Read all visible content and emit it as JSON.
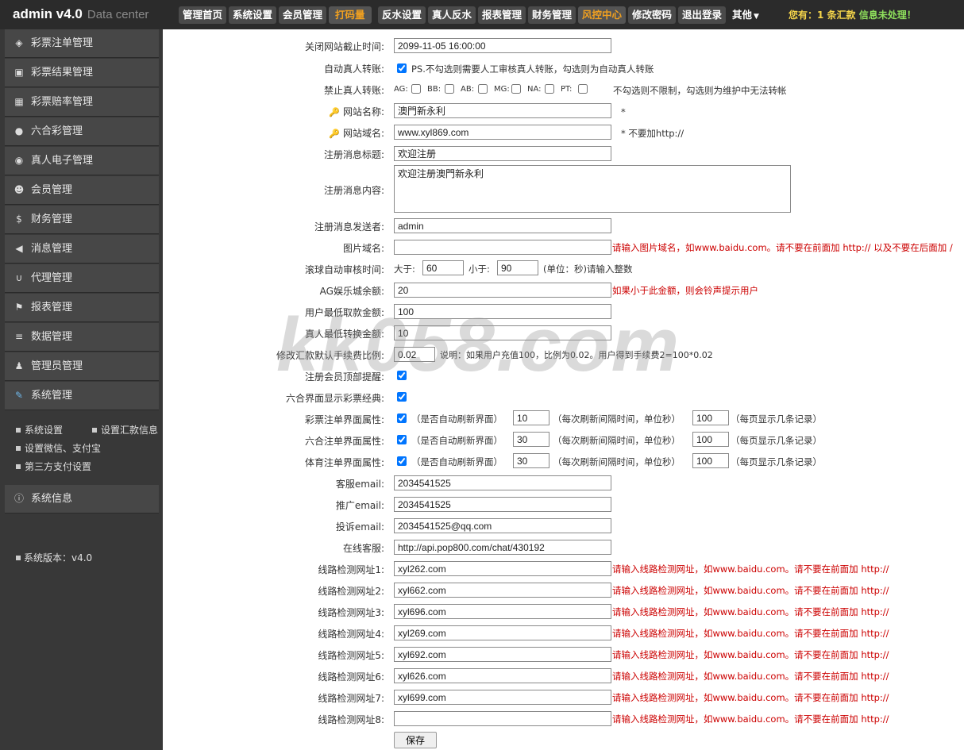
{
  "header": {
    "brand": "admin v4.0",
    "brand_sub": "Data center",
    "nav": [
      "管理首页",
      "系统设置",
      "会员管理",
      "打码量",
      "反水设置",
      "真人反水",
      "报表管理",
      "财务管理",
      "风控中心",
      "修改密码",
      "退出登录"
    ],
    "other": "其他",
    "notice_prefix": "您有：",
    "notice_count": "1",
    "notice_mid": " 条汇款 ",
    "notice_suffix": "信息未处理！"
  },
  "sidebar": {
    "items": [
      "彩票注单管理",
      "彩票结果管理",
      "彩票赔率管理",
      "六合彩管理",
      "真人电子管理",
      "会员管理",
      "财务管理",
      "消息管理",
      "代理管理",
      "报表管理",
      "数据管理",
      "管理员管理",
      "系统管理"
    ],
    "sub_items": [
      "系统设置",
      "设置汇款信息",
      "设置微信、支付宝",
      "第三方支付设置"
    ],
    "system_info": "系统信息",
    "version": "系统版本：v4.0"
  },
  "form": {
    "close_deadline": {
      "label": "关闭网站截止时间:",
      "value": "2099-11-05 16:00:00"
    },
    "auto_transfer": {
      "label": "自动真人转账:",
      "note": "PS.不勾选则需要人工审核真人转账，勾选则为自动真人转账"
    },
    "forbid_transfer": {
      "label": "禁止真人转账:",
      "options": [
        "AG:",
        "BB:",
        "AB:",
        "MG:",
        "NA:",
        "PT:"
      ],
      "note": "不勾选则不限制，勾选则为维护中无法转帐"
    },
    "site_name": {
      "label": "网站名称:",
      "value": "澳門新永利",
      "mark": "*"
    },
    "site_domain": {
      "label": "网站域名:",
      "value": "www.xyl869.com",
      "note": "*  不要加http://"
    },
    "reg_title": {
      "label": "注册消息标题:",
      "value": "欢迎注册"
    },
    "reg_content": {
      "label": "注册消息内容:",
      "value": "欢迎注册澳門新永利"
    },
    "reg_sender": {
      "label": "注册消息发送者:",
      "value": "admin"
    },
    "image_domain": {
      "label": "图片域名:",
      "value": "",
      "hint": "请输入图片域名，如www.baidu.com。请不要在前面加 http:// 以及不要在后面加 /"
    },
    "ball_auto_review": {
      "label": "滚球自动审核时间:",
      "gt": "大于:",
      "gt_value": "60",
      "lt": "小于:",
      "lt_value": "90",
      "unit": "(单位：秒)请输入整数"
    },
    "ag_balance": {
      "label": "AG娱乐城余额:",
      "value": "20",
      "hint": "如果小于此金额，则会铃声提示用户"
    },
    "min_withdraw": {
      "label": "用户最低取款金额:",
      "value": "100"
    },
    "min_transfer": {
      "label": "真人最低转换金额:",
      "value": "10"
    },
    "fee_ratio": {
      "label": "修改汇款默认手续费比例:",
      "value": "0.02",
      "note": "说明：如果用户充值100，比例为0.02。用户得到手续费2=100*0.02"
    },
    "reg_top_alert": {
      "label": "注册会员顶部提醒:"
    },
    "lhc_classic": {
      "label": "六合界面显示彩票经典:"
    },
    "page_attrs": [
      {
        "label": "彩票注单界面属性:",
        "refresh": "10",
        "per_page": "100"
      },
      {
        "label": "六合注单界面属性:",
        "refresh": "30",
        "per_page": "100"
      },
      {
        "label": "体育注单界面属性:",
        "refresh": "30",
        "per_page": "100"
      }
    ],
    "page_attr_text": {
      "auto": "（是否自动刷新界面）",
      "interval": "（每次刷新间隔时间，单位秒）",
      "count": "（每页显示几条记录）"
    },
    "service_email": {
      "label": "客服email:",
      "value": "2034541525"
    },
    "promo_email": {
      "label": "推广email:",
      "value": "2034541525"
    },
    "complaint_email": {
      "label": "投诉email:",
      "value": "2034541525@qq.com"
    },
    "online_service": {
      "label": "在线客服:",
      "value": "http://api.pop800.com/chat/430192"
    },
    "line_check": [
      {
        "label": "线路检测网址1:",
        "value": "xyl262.com"
      },
      {
        "label": "线路检测网址2:",
        "value": "xyl662.com"
      },
      {
        "label": "线路检测网址3:",
        "value": "xyl696.com"
      },
      {
        "label": "线路检测网址4:",
        "value": "xyl269.com"
      },
      {
        "label": "线路检测网址5:",
        "value": "xyl692.com"
      },
      {
        "label": "线路检测网址6:",
        "value": "xyl626.com"
      },
      {
        "label": "线路检测网址7:",
        "value": "xyl699.com"
      },
      {
        "label": "线路检测网址8:",
        "value": ""
      }
    ],
    "line_check_hint": "请输入线路检测网址，如www.baidu.com。请不要在前面加 http://",
    "save": "保存"
  },
  "watermark": "kk058.com",
  "colors": {
    "topbar": "#2b2b2b",
    "sidebar": "#383838",
    "accent_orange": "#f0a020",
    "hint_red": "#cc0000"
  }
}
